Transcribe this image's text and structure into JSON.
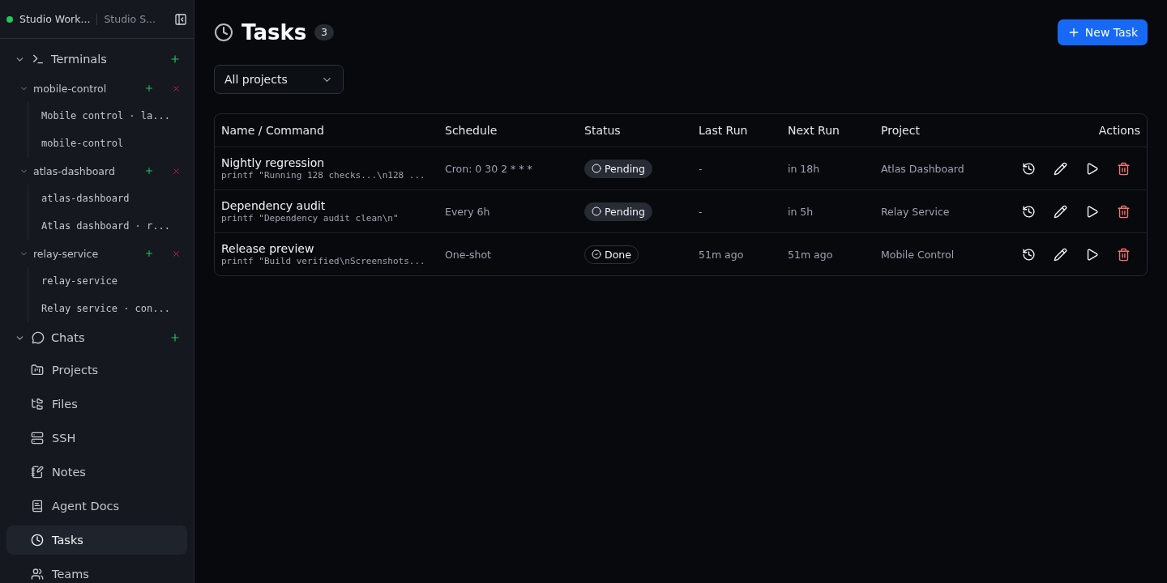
{
  "workspace": {
    "name": "Studio Work...",
    "secondary": "Studio S...",
    "online": true
  },
  "sidebar": {
    "sections": [
      {
        "label": "Terminals",
        "expanded": true,
        "groups": [
          {
            "label": "mobile-control",
            "expanded": true,
            "children": [
              {
                "label": "Mobile control · la..."
              },
              {
                "label": "mobile-control"
              }
            ]
          },
          {
            "label": "atlas-dashboard",
            "expanded": true,
            "children": [
              {
                "label": "atlas-dashboard"
              },
              {
                "label": "Atlas dashboard · r..."
              }
            ]
          },
          {
            "label": "relay-service",
            "expanded": true,
            "children": [
              {
                "label": "relay-service"
              },
              {
                "label": "Relay service · con..."
              }
            ]
          }
        ]
      },
      {
        "label": "Chats",
        "expanded": true
      }
    ],
    "nav_items": [
      {
        "label": "Projects",
        "selected": false
      },
      {
        "label": "Files",
        "selected": false
      },
      {
        "label": "SSH",
        "selected": false
      },
      {
        "label": "Notes",
        "selected": false
      },
      {
        "label": "Agent Docs",
        "selected": false
      },
      {
        "label": "Tasks",
        "selected": true
      },
      {
        "label": "Teams",
        "selected": false
      }
    ]
  },
  "page": {
    "title": "Tasks",
    "count": "3",
    "new_button": "New Task",
    "filter": "All projects"
  },
  "table": {
    "columns": [
      "Name / Command",
      "Schedule",
      "Status",
      "Last Run",
      "Next Run",
      "Project",
      "Actions"
    ],
    "rows": [
      {
        "name": "Nightly regression",
        "command": "printf \"Running 128 checks...\\n128 ...",
        "schedule": "Cron: 0 30 2 * * *",
        "status": {
          "kind": "pending",
          "label": "Pending"
        },
        "last_run": "-",
        "next_run": "in 18h",
        "project": "Atlas Dashboard"
      },
      {
        "name": "Dependency audit",
        "command": "printf \"Dependency audit clean\\n\"",
        "schedule": "Every 6h",
        "status": {
          "kind": "pending",
          "label": "Pending"
        },
        "last_run": "-",
        "next_run": "in 5h",
        "project": "Relay Service"
      },
      {
        "name": "Release preview",
        "command": "printf \"Build verified\\nScreenshots...",
        "schedule": "One-shot",
        "status": {
          "kind": "done",
          "label": "Done"
        },
        "last_run": "51m ago",
        "next_run": "51m ago",
        "project": "Mobile Control"
      }
    ]
  }
}
